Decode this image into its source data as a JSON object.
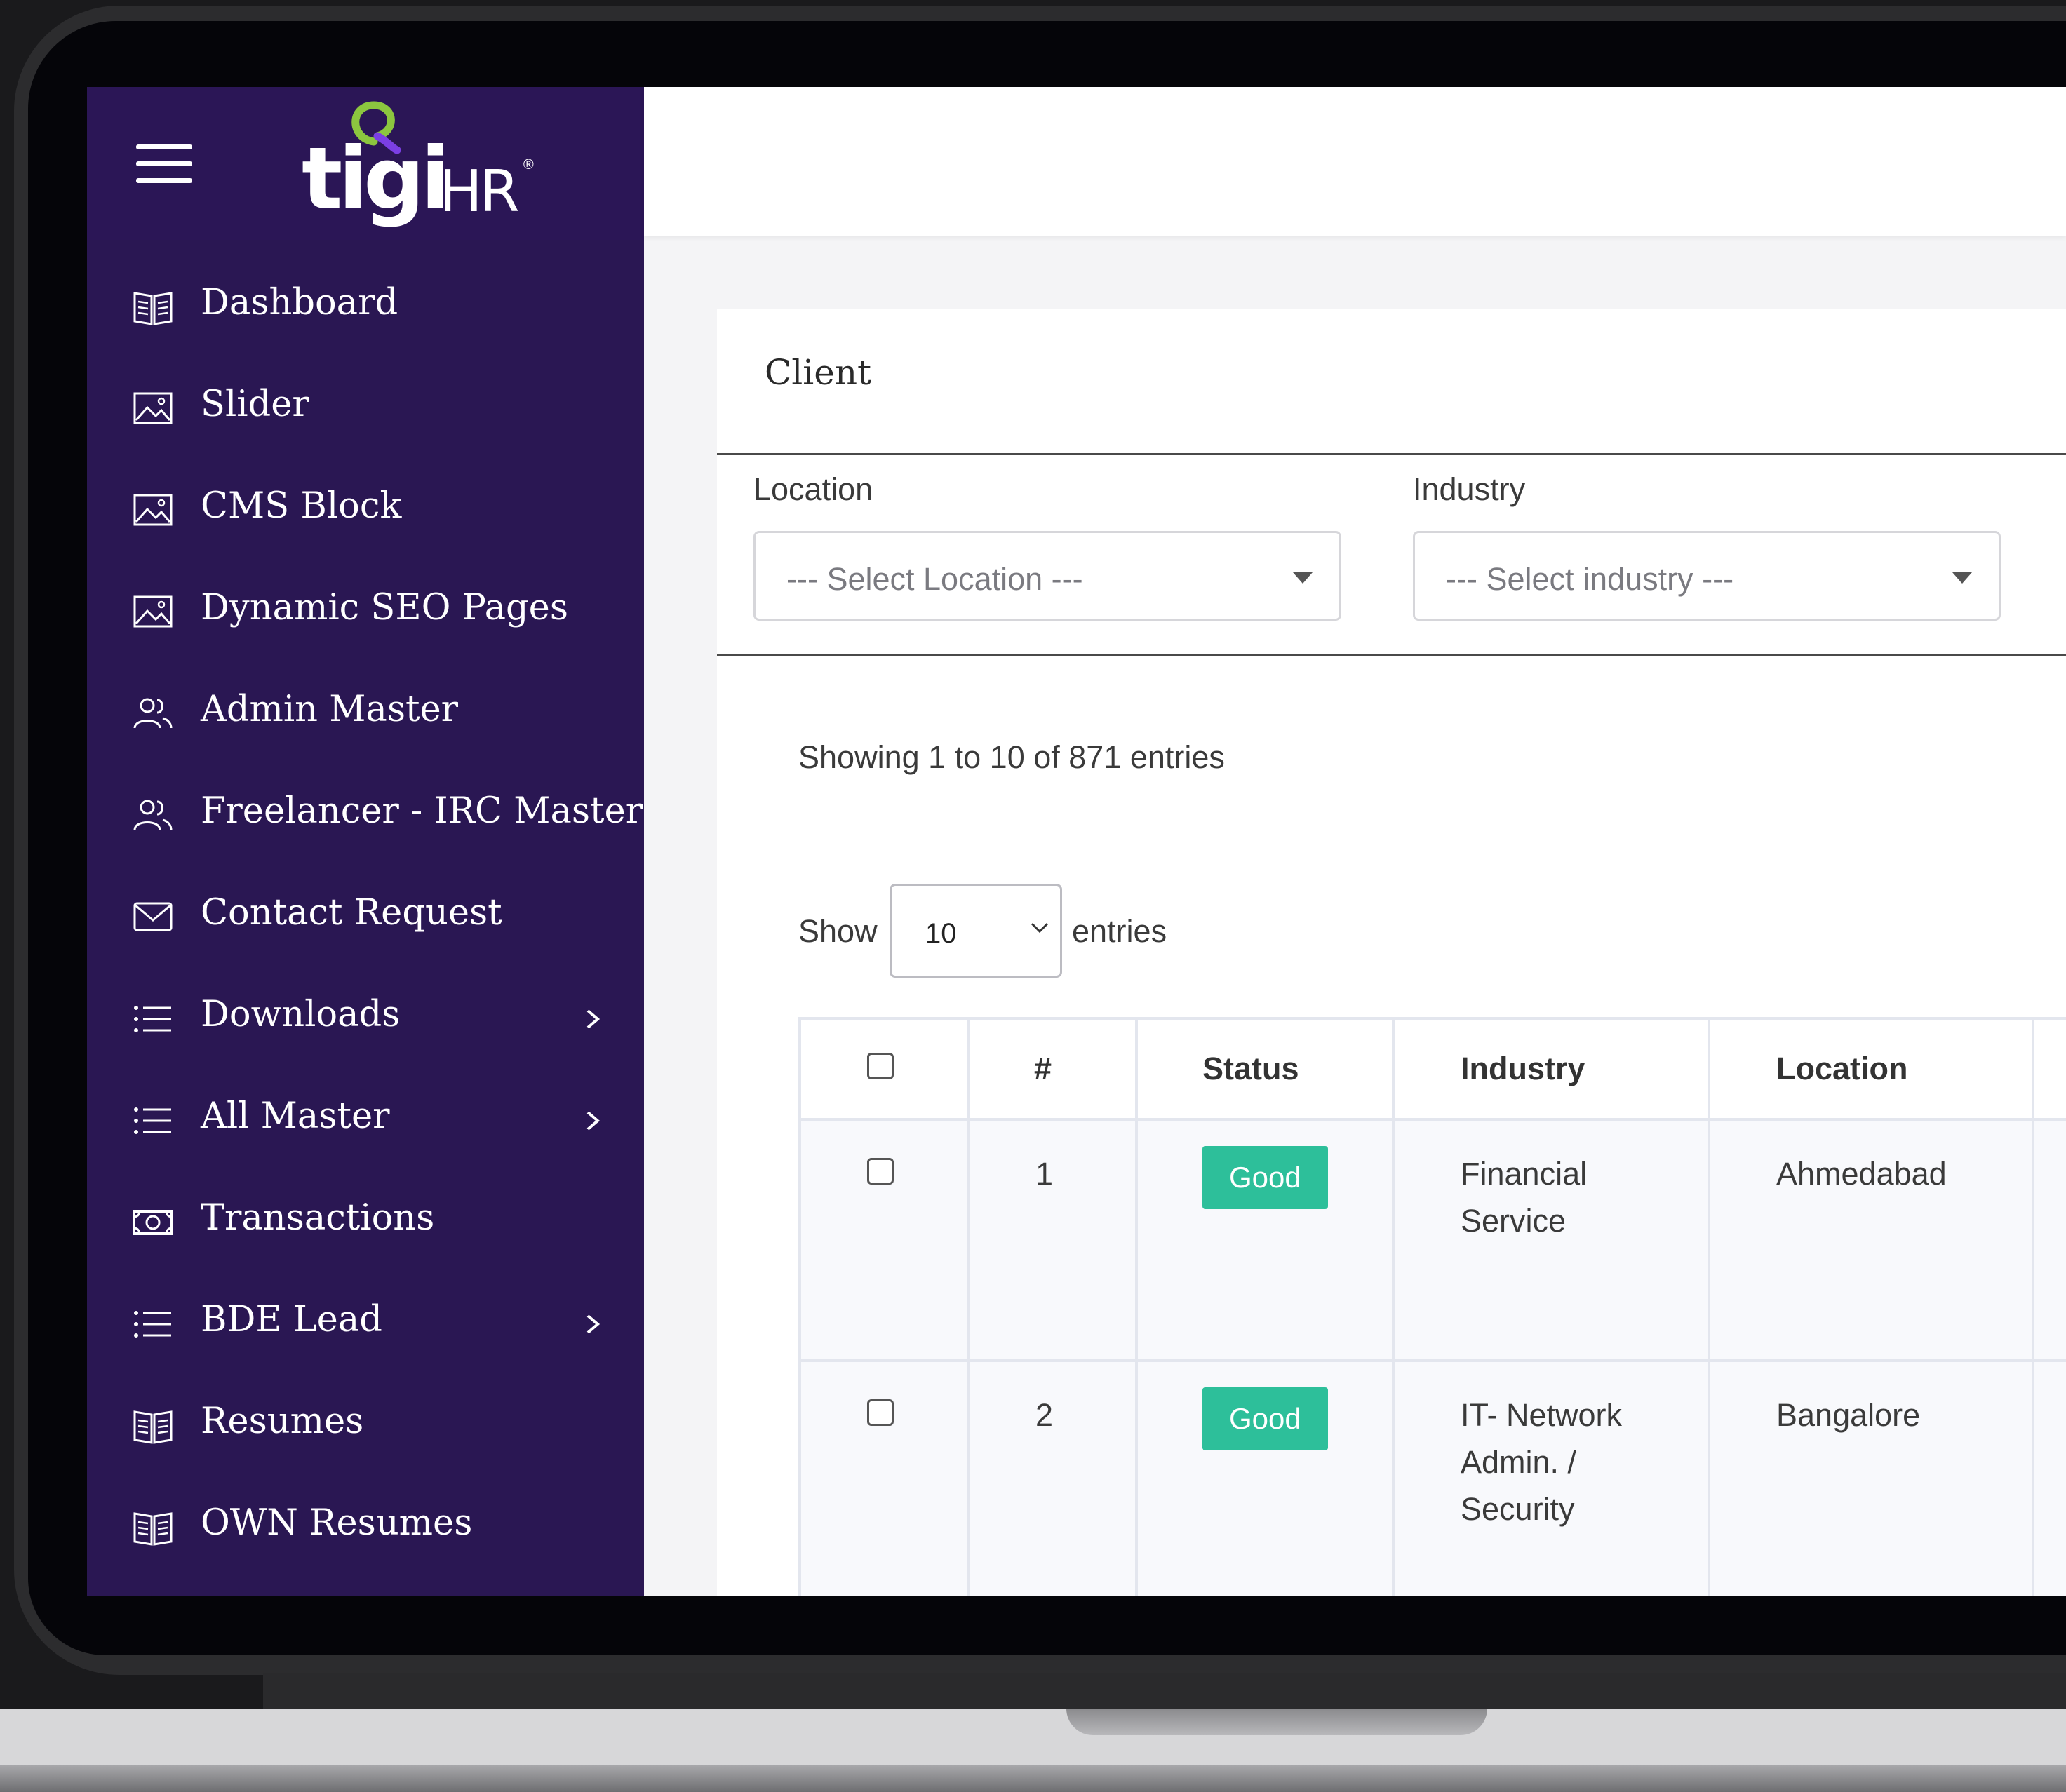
{
  "app": {
    "logo_text": "tigi",
    "logo_suffix": "HR",
    "logo_reg": "®"
  },
  "sidebar": {
    "items": [
      {
        "label": "Dashboard",
        "icon": "book-icon",
        "has_submenu": false
      },
      {
        "label": "Slider",
        "icon": "image-icon",
        "has_submenu": false
      },
      {
        "label": "CMS Block",
        "icon": "image-icon",
        "has_submenu": false
      },
      {
        "label": "Dynamic SEO Pages",
        "icon": "image-icon",
        "has_submenu": false
      },
      {
        "label": "Admin Master",
        "icon": "users-icon",
        "has_submenu": false
      },
      {
        "label": "Freelancer - IRC Master",
        "icon": "users-icon",
        "has_submenu": false
      },
      {
        "label": "Contact Request",
        "icon": "mail-icon",
        "has_submenu": false
      },
      {
        "label": "Downloads",
        "icon": "list-icon",
        "has_submenu": true
      },
      {
        "label": "All Master",
        "icon": "list-icon",
        "has_submenu": true
      },
      {
        "label": "Transactions",
        "icon": "money-icon",
        "has_submenu": false
      },
      {
        "label": "BDE Lead",
        "icon": "list-icon",
        "has_submenu": true
      },
      {
        "label": "Resumes",
        "icon": "book-icon",
        "has_submenu": false
      },
      {
        "label": "OWN Resumes",
        "icon": "book-icon",
        "has_submenu": false
      }
    ]
  },
  "main": {
    "card_title": "Client",
    "filters": {
      "location_label": "Location",
      "location_placeholder": "--- Select Location ---",
      "industry_label": "Industry",
      "industry_placeholder": "--- Select industry ---"
    },
    "showing_text": "Showing 1 to 10 of 871 entries",
    "show_label": "Show",
    "entries_value": "10",
    "entries_label": "entries",
    "table": {
      "headers": [
        "#",
        "Status",
        "Industry",
        "Location"
      ],
      "rows": [
        {
          "num": "1",
          "status": "Good",
          "industry_line1": "Financial",
          "industry_line2": "Service",
          "industry_line3": "",
          "location": "Ahmedabad"
        },
        {
          "num": "2",
          "status": "Good",
          "industry_line1": "IT- Network",
          "industry_line2": "Admin. /",
          "industry_line3": "Security",
          "location": "Bangalore"
        }
      ]
    }
  },
  "colors": {
    "sidebar_bg": "#2a1753",
    "status_good": "#2dbf9a",
    "logo_accent_green": "#8cc63f",
    "logo_accent_purple": "#7b3fe4"
  }
}
